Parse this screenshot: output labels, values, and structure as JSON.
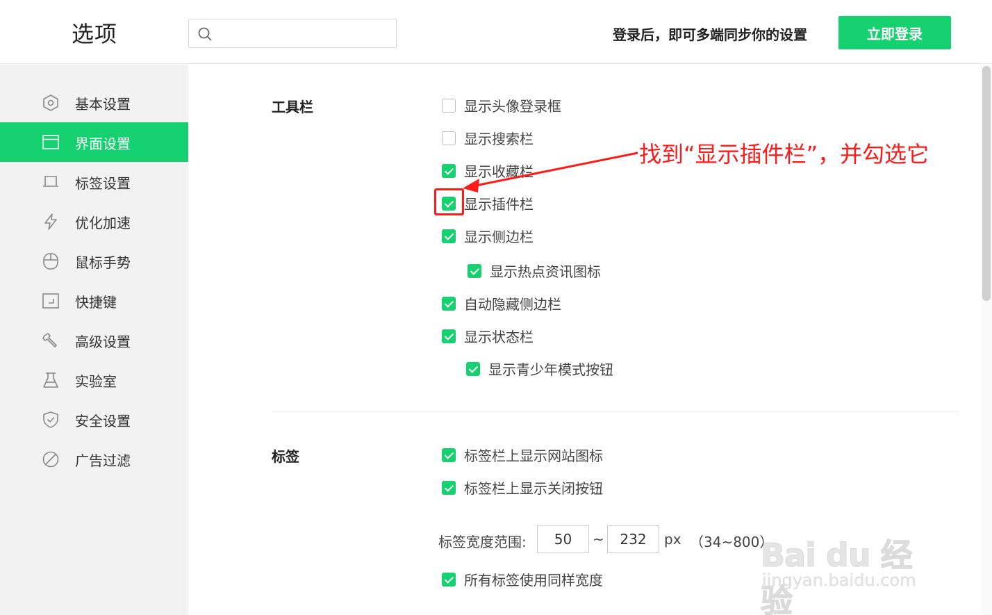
{
  "header": {
    "title": "选项",
    "search_placeholder": "",
    "login_hint": "登录后，即可多端同步你的设置",
    "login_button": "立即登录"
  },
  "sidebar": {
    "items": [
      {
        "label": "基本设置",
        "icon": "settings-hex-icon",
        "active": false
      },
      {
        "label": "界面设置",
        "icon": "window-icon",
        "active": true
      },
      {
        "label": "标签设置",
        "icon": "tab-icon",
        "active": false
      },
      {
        "label": "优化加速",
        "icon": "lightning-icon",
        "active": false
      },
      {
        "label": "鼠标手势",
        "icon": "mouse-icon",
        "active": false
      },
      {
        "label": "快捷键",
        "icon": "shortcut-icon",
        "active": false
      },
      {
        "label": "高级设置",
        "icon": "wrench-icon",
        "active": false
      },
      {
        "label": "实验室",
        "icon": "flask-icon",
        "active": false
      },
      {
        "label": "安全设置",
        "icon": "shield-icon",
        "active": false
      },
      {
        "label": "广告过滤",
        "icon": "block-icon",
        "active": false
      }
    ]
  },
  "toolbar_section": {
    "title": "工具栏",
    "options": [
      {
        "label": "显示头像登录框",
        "checked": false
      },
      {
        "label": "显示搜索栏",
        "checked": false
      },
      {
        "label": "显示收藏栏",
        "checked": true
      },
      {
        "label": "显示插件栏",
        "checked": true
      },
      {
        "label": "显示侧边栏",
        "checked": true
      },
      {
        "label": "显示热点资讯图标",
        "checked": true
      },
      {
        "label": "自动隐藏侧边栏",
        "checked": true
      },
      {
        "label": "显示状态栏",
        "checked": true
      },
      {
        "label": "显示青少年模式按钮",
        "checked": true
      }
    ]
  },
  "tabs_section": {
    "title": "标签",
    "options": [
      {
        "label": "标签栏上显示网站图标",
        "checked": true
      },
      {
        "label": "标签栏上显示关闭按钮",
        "checked": true
      },
      {
        "label": "所有标签使用同样宽度",
        "checked": true
      }
    ],
    "width_range": {
      "label": "标签宽度范围:",
      "min_value": "50",
      "separator": "~",
      "max_value": "232",
      "unit": "px",
      "range_hint": "（34~800）"
    }
  },
  "annotation": {
    "text": "找到“显示插件栏”，并勾选它",
    "color": "#ff1a1a"
  },
  "watermark": {
    "logo": "Bai du 经验",
    "url": "jingyan.baidu.com"
  },
  "colors": {
    "accent": "#16d16f",
    "sidebar_bg": "#f2f2f2"
  }
}
